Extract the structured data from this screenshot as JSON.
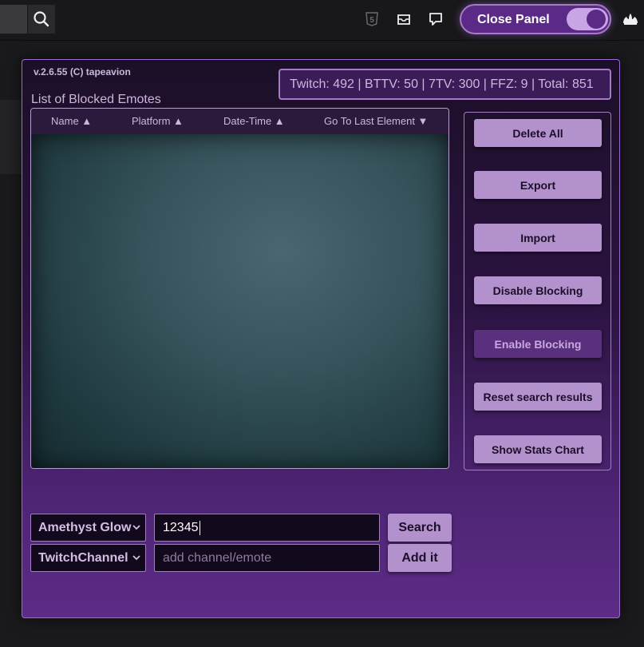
{
  "topbar": {
    "icons": [
      "search-icon",
      "html5-icon",
      "inbox-icon",
      "chat-icon",
      "crown-icon"
    ],
    "close_panel_label": "Close Panel",
    "toggle_on": true
  },
  "panel": {
    "version": "v.2.6.55 (C) tapeavion",
    "stats": "Twitch: 492 | BTTV: 50 | 7TV: 300 | FFZ: 9 | Total: 851",
    "list_title": "List of Blocked Emotes",
    "columns": [
      "Name ▲",
      "Platform ▲",
      "Date-Time ▲",
      "Go To Last Element ▼"
    ],
    "buttons": {
      "delete_all": "Delete All",
      "export": "Export",
      "import": "Import",
      "disable_blocking": "Disable Blocking",
      "enable_blocking": "Enable Blocking",
      "reset_search": "Reset search results",
      "show_stats": "Show Stats Chart"
    },
    "theme_select": "Amethyst Glow",
    "search_value": "12345",
    "search_button": "Search",
    "type_select": "TwitchChannel",
    "add_placeholder": "add channel/emote",
    "add_button": "Add it"
  },
  "colors": {
    "accent": "#b391cc",
    "accent_dim": "#5a2f7d",
    "border": "#a57cc4",
    "panel_bottom": "#5c2c86"
  }
}
